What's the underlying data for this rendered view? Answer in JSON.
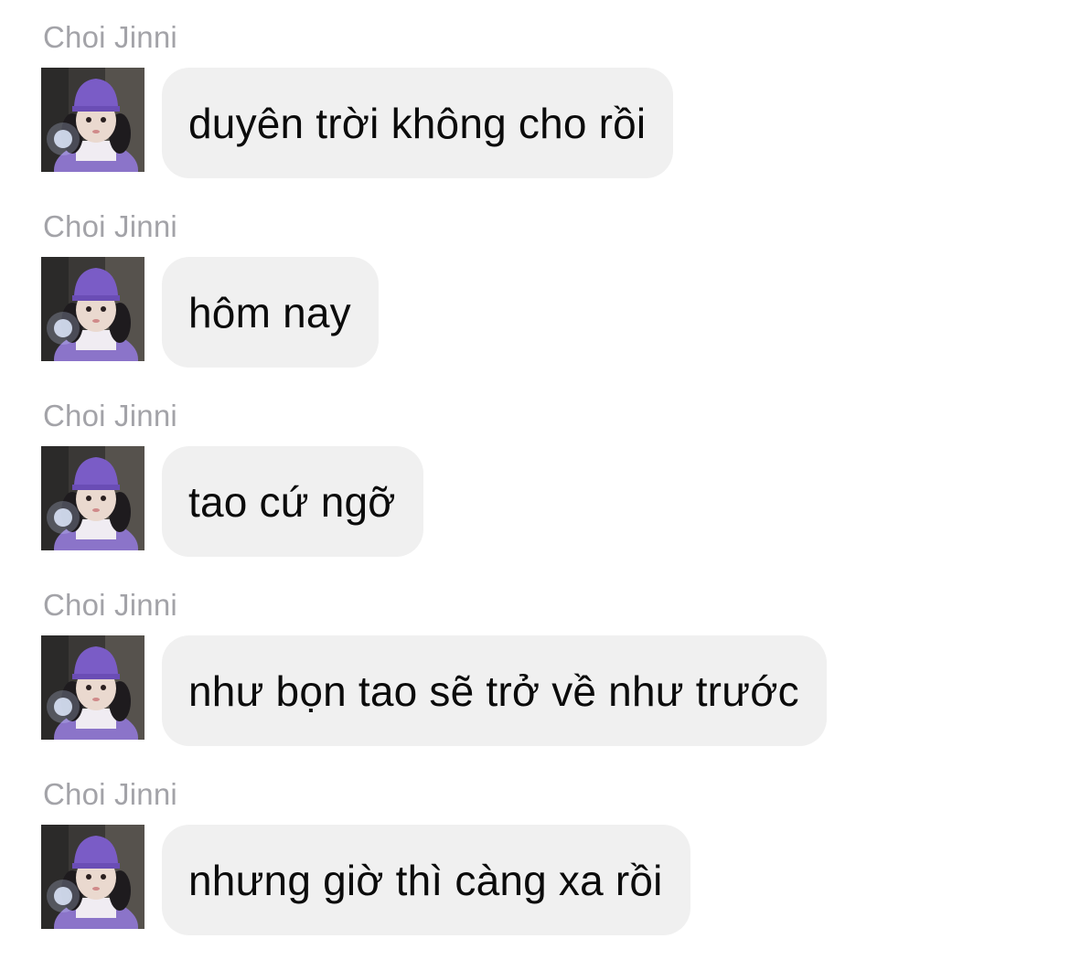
{
  "conversation": {
    "messages": [
      {
        "sender": "Choi Jinni",
        "text": "duyên trời không cho rồi",
        "avatar_icon": "profile-photo"
      },
      {
        "sender": "Choi Jinni",
        "text": "hôm nay",
        "avatar_icon": "profile-photo"
      },
      {
        "sender": "Choi Jinni",
        "text": "tao cứ ngỡ",
        "avatar_icon": "profile-photo"
      },
      {
        "sender": "Choi Jinni",
        "text": "như bọn tao sẽ trở về như trước",
        "avatar_icon": "profile-photo"
      },
      {
        "sender": "Choi Jinni",
        "text": "nhưng giờ thì càng xa rồi",
        "avatar_icon": "profile-photo"
      }
    ]
  },
  "colors": {
    "bubble_background": "#f0f0f0",
    "sender_name": "#a3a3a8",
    "message_text": "#0b0b0b",
    "avatar_hat": "#7a5cc6"
  }
}
